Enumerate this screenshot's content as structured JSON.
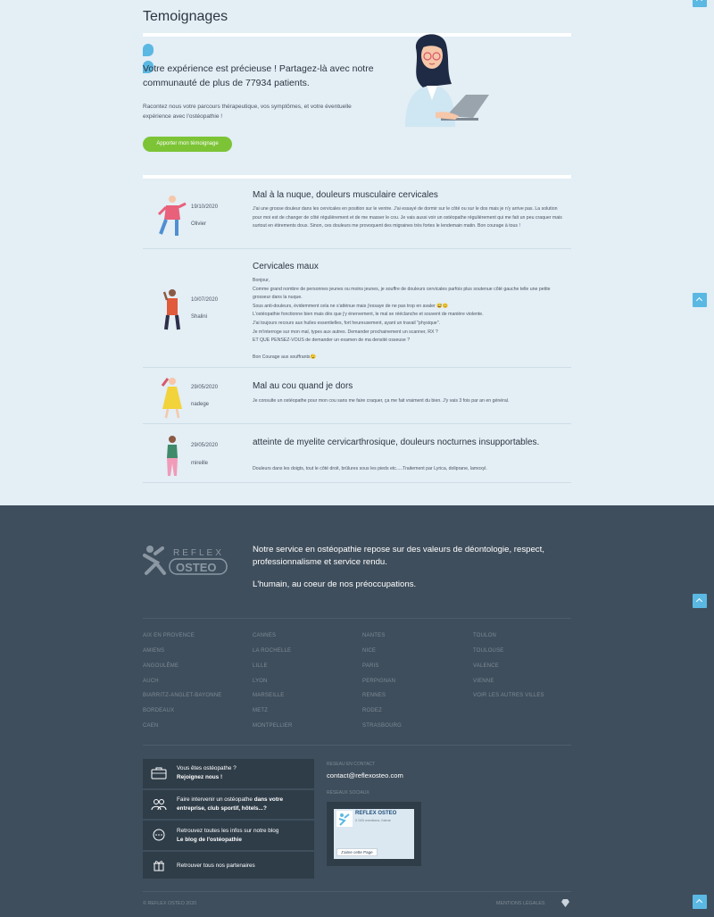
{
  "testimonials_section": {
    "title": "Temoignages",
    "headline": "Votre expérience est précieuse ! Partagez-là avec notre communauté de plus de 77934 patients.",
    "intro": "Racontez nous votre parcours thérapeutique, vos symptômes, et votre éventuelle expérience avec l'ostéopathie !",
    "cta_label": "Apporter mon témoignage"
  },
  "testimonials": [
    {
      "date": "19/10/2020",
      "author": "Olivier",
      "title": "Mal à la nuque, douleurs musculaire cervicales",
      "body": "J'ai une grosse douleur dans les cervicales en position sur le ventre. J'ai essayé de dormir sur le côté ou sur le dos mais je n'y arrive pas. La solution pour moi est de changer de côté régulièrement et de me masser le cou. Je vais aussi voir un ostéopathe régulièrement qui me fait un peu craquer mais surtout en étirements doux. Sinon, ces douleurs me provoquent des migraines très fortes le lendemain matin. Bon courage à tous !"
    },
    {
      "date": "10/07/2020",
      "author": "Shalini",
      "title": "Cervicales maux",
      "body": "Bonjour,\nComme grand nombre de personnes jeunes ou moins jeunes, je souffre de douleurs cervicales parfois plus soutenue côté gauche telle une petite grosseur dans la nuque.\nSous anti-douleurs, évidemment cela ne s'atténue mais j'essaye de ne pas trop en avaler 😅😊\nL'ostéopathie fonctionne bien mais dès que j'y énervement, le mal se rééclanche et souvent de manière violente.\nJ'ai toujours recours aux huiles essentielles, fort heureusement, ayant un travail \"physique\".\nJe m'interroge sur mon mal, types aux autres. Demander prochainement un scanner, RX ?\nET QUE PENSEZ-VOUS de demander un examen de ma densité osseuse ?\n\nBon Courage aux souffrants😉"
    },
    {
      "date": "29/05/2020",
      "author": "nadege",
      "title": "Mal au cou quand je dors",
      "body": "Je consulte un ostéopathe pour mon cou sans me faire craquer, ça me fait vraiment du bien. J'y vais 3 fois par an en général."
    },
    {
      "date": "29/05/2020",
      "author": "mireille",
      "title": "atteinte de myelite cervicarthrosique, douleurs nocturnes insupportables.",
      "body": "Douleurs dans les doigts, tout le côté droit, brûlures sous les pieds etc.....Traitement par Lyrica, doliprane, lamoxyl."
    }
  ],
  "footer": {
    "logo_top": "REFLEX",
    "logo_bottom": "OSTEO",
    "mission": "Notre service en ostéopathie repose sur des valeurs de déontologie, respect, professionnalisme et service rendu.",
    "human": "L'humain, au coeur de nos préoccupations.",
    "city_columns": [
      [
        "AIX EN PROVENCE",
        "AMIENS",
        "ANGOULÊME",
        "AUCH",
        "BIARRITZ-ANGLET-BAYONNE",
        "BORDEAUX",
        "CAEN"
      ],
      [
        "CANNES",
        "LA ROCHELLE",
        "LILLE",
        "LYON",
        "MARSEILLE",
        "METZ",
        "MONTPELLIER"
      ],
      [
        "NANTES",
        "NICE",
        "PARIS",
        "PERPIGNAN",
        "RENNES",
        "RODEZ",
        "STRASBOURG"
      ],
      [
        "TOULON",
        "TOULOUSE",
        "VALENCE",
        "VIENNE",
        "VOIR LES AUTRES VILLES"
      ]
    ],
    "boxes": [
      {
        "line1": "Vous êtes ostéopathe ?",
        "line2": "Rejoignez nous !"
      },
      {
        "line1": "Faire intervenir un ostéopathe",
        "line1b": "dans votre",
        "line2": "entreprise, club sportif, hôtels...?"
      },
      {
        "line1": "Retrouvez toutes les infos sur notre blog",
        "line2": "Le blog de l'ostéopathie"
      },
      {
        "line1": "Retrouver tous nos partenaires"
      }
    ],
    "contact_label": "RESEAU EN CONTACT",
    "contact_email": "contact@reflexosteo.com",
    "social_label": "RÉSEAUX SOCIAUX",
    "fb_page_name": "REFLEX OSTEO",
    "fb_page_sub": "2 020 mentions J'aime",
    "fb_like": "J'aime cette Page",
    "copyright": "© REFLEX OSTEO 2020",
    "legal": "MENTIONS LÉGALES"
  },
  "colors": {
    "background": "#e3eef5",
    "accent_blue": "#5ab8e3",
    "cta_green": "#7cc436",
    "footer_bg": "#3f4e5c"
  }
}
